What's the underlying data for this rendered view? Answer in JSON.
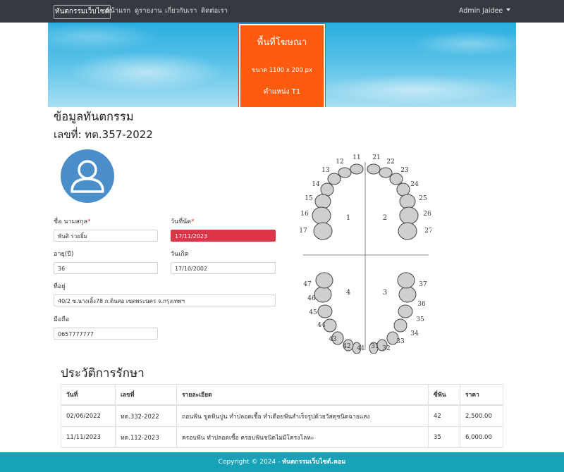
{
  "navbar": {
    "brand": "ทันตกรรมเว็บไซต์",
    "links": [
      "หน้าแรก",
      "ดูรายงาน",
      "เกี่ยวกับเรา",
      "ติดต่อเรา"
    ],
    "user": "Admin Jaidee"
  },
  "banner": {
    "ad_title": "พื้นที่โฆษณา",
    "ad_size": "ขนาด 1100 x 200 px",
    "ad_position": "ตำแหน่ง T1"
  },
  "record": {
    "title": "ข้อมูลทันตกรรม",
    "number": "เลขที่: ทต.357-2022"
  },
  "form": {
    "name_label": "ชื่อ นามสกุล",
    "name_value": "พันติ รวยยิ้ม",
    "appointment_label": "วันที่นัด",
    "appointment_value": "17/11/2023",
    "age_label": "อายุ(ปี)",
    "age_value": "36",
    "birthdate_label": "วันเกิด",
    "birthdate_value": "17/10/2002",
    "address_label": "ที่อยู่",
    "address_value": "40/2 ซ.นางเลิ้ง78 ถ.ดินสอ เขตพระนคร จ.กรุงเทพฯ",
    "phone_label": "มือถือ",
    "phone_value": "0657777777",
    "required_mark": "*"
  },
  "tooth_chart": {
    "quadrants": [
      "1",
      "2",
      "3",
      "4"
    ],
    "upper_right": [
      "11",
      "12",
      "13",
      "14",
      "15",
      "16",
      "17"
    ],
    "upper_left": [
      "21",
      "22",
      "23",
      "24",
      "25",
      "26",
      "27"
    ],
    "lower_left": [
      "31",
      "32",
      "33",
      "34",
      "35",
      "36",
      "37"
    ],
    "lower_right": [
      "41",
      "42",
      "43",
      "44",
      "45",
      "46",
      "47"
    ]
  },
  "history": {
    "title": "ประวัติการรักษา",
    "columns": [
      "วันที่",
      "เลขที่",
      "รายละเอียด",
      "ซี่ฟัน",
      "ราคา"
    ],
    "rows": [
      [
        "02/06/2022",
        "ทต.332-2022",
        "ถอนฟัน ขูดหินปูน ทำปลอดเชื้อ ทำเดือยฟันสำเร็จรูปด้วยวัสดุชนิดฉายแสง",
        "42",
        "2,500.00"
      ],
      [
        "11/11/2023",
        "ทต.112-2023",
        "ครอบฟัน ทำปลอดเชื้อ ครอบฟันชนิดไม่มีโครงโลหะ",
        "35",
        "6,000.00"
      ]
    ]
  },
  "footer": {
    "text": "Copyright © 2024 - ",
    "site": "ทันตกรรมเว็บไซต์.คอม"
  },
  "colors": {
    "navbar": "#343a40",
    "ad_orange": "#ff5b0f",
    "avatar_blue": "#4a8fca",
    "invalid_red": "#dc3545",
    "footer_teal": "#17a2b8"
  }
}
